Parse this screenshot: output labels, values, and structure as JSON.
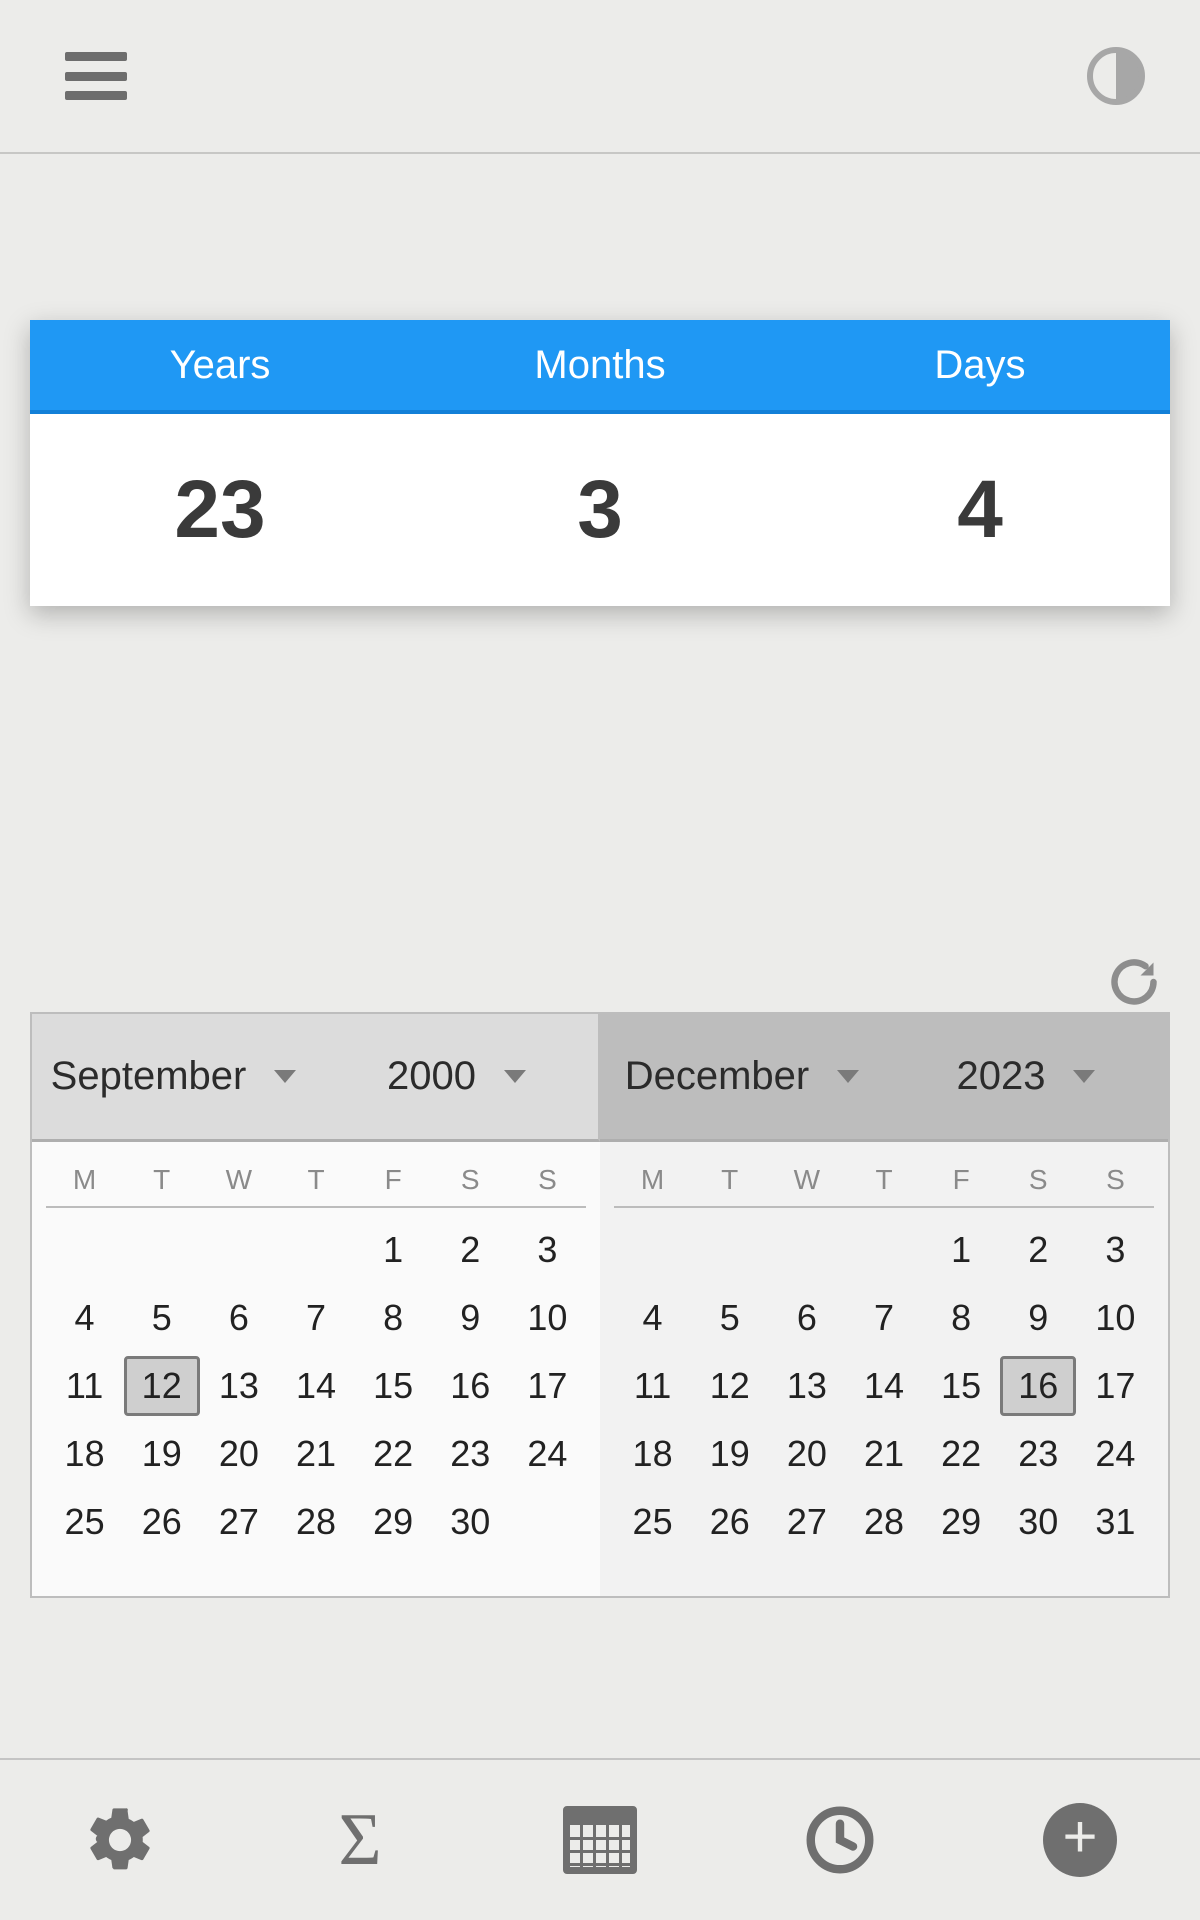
{
  "result": {
    "headers": [
      "Years",
      "Months",
      "Days"
    ],
    "values": [
      "23",
      "3",
      "4"
    ]
  },
  "left_cal": {
    "month": "September",
    "year": "2000",
    "dow": [
      "M",
      "T",
      "W",
      "T",
      "F",
      "S",
      "S"
    ],
    "leading_blanks": 4,
    "days": 30,
    "selected": 12
  },
  "right_cal": {
    "month": "December",
    "year": "2023",
    "dow": [
      "M",
      "T",
      "W",
      "T",
      "F",
      "S",
      "S"
    ],
    "leading_blanks": 4,
    "days": 31,
    "selected": 16
  }
}
